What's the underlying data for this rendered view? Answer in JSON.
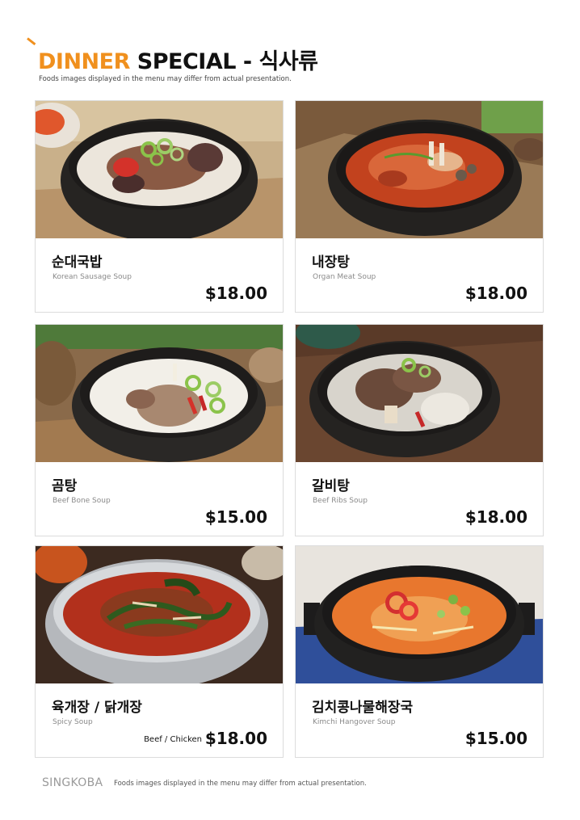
{
  "header": {
    "title_part1": "DINNER",
    "title_part2": "SPECIAL",
    "title_part3": "- 식사류",
    "disclaimer": "Foods images displayed in the menu may differ from actual presentation."
  },
  "colors": {
    "accent": "#f0901e",
    "text": "#111111",
    "subtext": "#8a8a8a",
    "border": "#dcdcdc"
  },
  "menu": [
    {
      "name_ko": "순대국밥",
      "name_en": "Korean Sausage Soup",
      "price": "$18.00",
      "variant": "",
      "image": "sundae-gukbap-photo"
    },
    {
      "name_ko": "내장탕",
      "name_en": "Organ Meat Soup",
      "price": "$18.00",
      "variant": "",
      "image": "naejangtang-photo"
    },
    {
      "name_ko": "곰탕",
      "name_en": "Beef Bone Soup",
      "price": "$15.00",
      "variant": "",
      "image": "gomtang-photo"
    },
    {
      "name_ko": "갈비탕",
      "name_en": "Beef Ribs Soup",
      "price": "$18.00",
      "variant": "",
      "image": "galbitang-photo"
    },
    {
      "name_ko": "육개장 / 닭개장",
      "name_en": "Spicy Soup",
      "price": "$18.00",
      "variant": "Beef  / Chicken",
      "image": "yukgaejang-photo"
    },
    {
      "name_ko": "김치콩나물해장국",
      "name_en": "Kimchi Hangover Soup",
      "price": "$15.00",
      "variant": "",
      "image": "haejangguk-photo"
    }
  ],
  "footer": {
    "brand": "SINGKOBA",
    "note": "Foods images displayed in the menu may differ from actual presentation."
  }
}
